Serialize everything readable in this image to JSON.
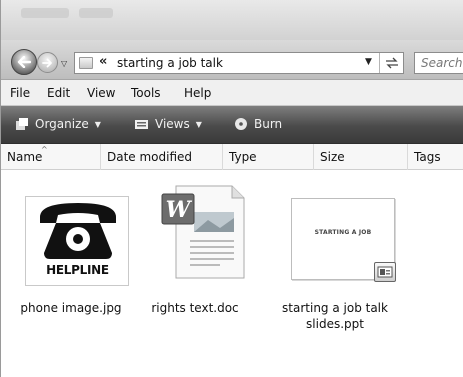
{
  "address": {
    "separator": "«",
    "path": "starting a job talk",
    "search_placeholder": "Search"
  },
  "menu": [
    "File",
    "Edit",
    "View",
    "Tools",
    "Help"
  ],
  "toolbar": {
    "organize": "Organize",
    "views": "Views",
    "burn": "Burn"
  },
  "columns": [
    "Name",
    "Date modified",
    "Type",
    "Size",
    "Tags"
  ],
  "files": [
    {
      "name": "phone image.jpg",
      "thumb_text": "HELPLINE",
      "icon": "telephone-icon"
    },
    {
      "name": "rights text.doc",
      "icon": "word-document-icon"
    },
    {
      "name_line1": "starting a job talk",
      "name_line2": "slides.ppt",
      "thumb_text": "STARTING A JOB",
      "icon": "powerpoint-slide-icon"
    }
  ],
  "colors": {
    "toolbar_dark": "#3a3a3a",
    "window_bg": "#ffffff"
  }
}
